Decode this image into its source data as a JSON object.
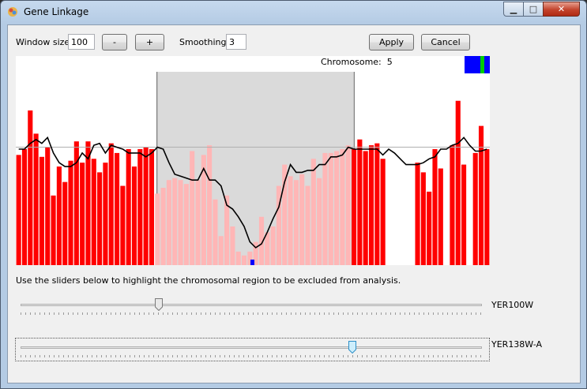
{
  "window": {
    "title": "Gene Linkage",
    "min_glyph": "▁",
    "max_glyph": "□",
    "close_glyph": "✕"
  },
  "controls": {
    "window_size_label": "Window size:",
    "window_size_value": "100",
    "minus_label": "-",
    "plus_label": "+",
    "smoothing_label": "Smoothing:",
    "smoothing_value": "3",
    "apply_label": "Apply",
    "cancel_label": "Cancel"
  },
  "plot": {
    "chromosome_label": "Chromosome:",
    "chromosome_value": "5"
  },
  "instructions": "Use the sliders below to highlight the chromosomal region to be excluded from analysis.",
  "sliders": [
    {
      "label": "YER100W",
      "value_fraction": 0.3
    },
    {
      "label": "YER138W-A",
      "value_fraction": 0.72
    }
  ],
  "colors": {
    "bar_included": "#ff0000",
    "bar_excluded": "#ffb6b6",
    "excluded_region": "#dadada",
    "trend_line": "#000000",
    "baseline": "#b0b0b0",
    "marker_blue": "#0000ff",
    "marker_green": "#00cc00"
  },
  "chart_data": {
    "type": "bar",
    "excluded_range_fraction": [
      0.297,
      0.713
    ],
    "baseline_level": 0.61,
    "bars": [
      0.57,
      0.6,
      0.8,
      0.68,
      0.56,
      0.61,
      0.36,
      0.51,
      0.43,
      0.54,
      0.64,
      0.53,
      0.64,
      0.55,
      0.48,
      0.53,
      0.63,
      0.58,
      0.41,
      0.6,
      0.51,
      0.6,
      0.61,
      0.6,
      0.37,
      0.4,
      0.44,
      0.45,
      0.44,
      0.42,
      0.59,
      0.44,
      0.57,
      0.62,
      0.34,
      0.15,
      0.36,
      0.2,
      0.07,
      0.05,
      0.07,
      0.12,
      0.25,
      0.17,
      0.2,
      0.41,
      0.52,
      0.46,
      0.44,
      0.47,
      0.41,
      0.55,
      0.45,
      0.58,
      0.58,
      0.59,
      0.6,
      0.62,
      0.6,
      0.65,
      0.59,
      0.62,
      0.63,
      0.55,
      0.0,
      0.0,
      0.0,
      0.0,
      0.0,
      0.53,
      0.48,
      0.38,
      0.6,
      0.5,
      0.0,
      0.62,
      0.85,
      0.52,
      0.0,
      0.58,
      0.72,
      0.6
    ],
    "trend": [
      0.6,
      0.6,
      0.63,
      0.65,
      0.63,
      0.66,
      0.58,
      0.53,
      0.51,
      0.51,
      0.53,
      0.58,
      0.55,
      0.62,
      0.63,
      0.58,
      0.62,
      0.61,
      0.6,
      0.58,
      0.58,
      0.58,
      0.56,
      0.58,
      0.61,
      0.6,
      0.53,
      0.47,
      0.46,
      0.45,
      0.44,
      0.44,
      0.5,
      0.44,
      0.44,
      0.41,
      0.31,
      0.29,
      0.25,
      0.2,
      0.12,
      0.09,
      0.11,
      0.17,
      0.24,
      0.3,
      0.43,
      0.52,
      0.48,
      0.48,
      0.49,
      0.49,
      0.52,
      0.52,
      0.56,
      0.56,
      0.57,
      0.61,
      0.6,
      0.6,
      0.6,
      0.6,
      0.6,
      0.57,
      0.6,
      0.58,
      0.55,
      0.52,
      0.52,
      0.52,
      0.53,
      0.55,
      0.56,
      0.6,
      0.6,
      0.62,
      0.63,
      0.66,
      0.62,
      0.59,
      0.59,
      0.6
    ]
  }
}
